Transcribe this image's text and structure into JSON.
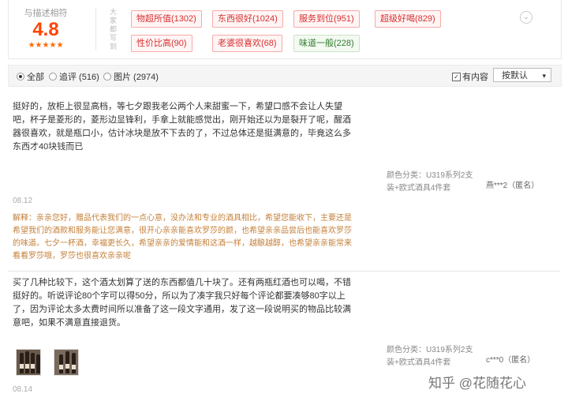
{
  "rating": {
    "label": "与描述相符",
    "score": "4.8",
    "stars": "★★★★★",
    "impressions_label": "大家都写到"
  },
  "tags": [
    {
      "text": "物超所值(1302)",
      "tone": "positive"
    },
    {
      "text": "东西很好(1024)",
      "tone": "positive"
    },
    {
      "text": "服务到位(951)",
      "tone": "positive"
    },
    {
      "text": "超级好喝(829)",
      "tone": "positive"
    },
    {
      "text": "性价比高(90)",
      "tone": "positive"
    },
    {
      "text": "老婆很喜欢(68)",
      "tone": "positive"
    },
    {
      "text": "味道一般(228)",
      "tone": "neutral"
    }
  ],
  "filter": {
    "all": "全部",
    "append": "追评 (516)",
    "photo": "图片 (2974)",
    "has_content": "有内容",
    "sort": "按默认",
    "sort_arrow": "▾",
    "check": "✓",
    "chevron": "⌄"
  },
  "reviews": [
    {
      "text": "挺好的，放柜上很显高档，等七夕跟我老公两个人来甜蜜一下，希望口感不会让人失望吧，杯子是菱形的，菱形边显锋利，手拿上就能感觉出，刚开始还以为是裂开了呢，醒酒器很喜欢，就是瓶口小，估计冰块是放不下去的了，不过总体还是挺满意的，毕竟这么多东西才40块钱而已",
      "sku": "颜色分类：U319系列2支装+欧式酒具4件套",
      "user": "燕***2（匿名）",
      "date": "08.12",
      "reply": "解释：亲亲您好，赠品代表我们的一点心意，没办法和专业的酒具相比，希望您能收下，主要还是希望我们的酒款和服务能让您满意，很开心亲亲能喜欢罗莎的颜，也希望亲亲品尝后也能喜欢罗莎的味道。七夕一杯酒，幸福更长久，希望亲亲的爱情能和这酒一样，越酿越醇，也希望亲亲能常来看看罗莎哦，罗莎也很喜欢亲亲呢"
    },
    {
      "text": "买了几种比较下，这个酒太划算了送的东西都值几十块了。还有两瓶红酒也可以喝，不错挺好的。听说评论80个字可以得50分，所以为了凑字我只好每个评论都要凑够80字以上了，因为评论太多太费时间所以准备了这一段文字通用，发了这一段说明买的物品比较满意吧，如果不满意直接退货。",
      "sku": "颜色分类：U319系列2支装+欧式酒具4件套",
      "user": "c***0（匿名）",
      "date": "08.14"
    }
  ],
  "watermark": "知乎 @花随花心",
  "colors": {
    "accent": "#ff4400",
    "tag_red": "#d72f2f",
    "reply": "#c5803a"
  }
}
